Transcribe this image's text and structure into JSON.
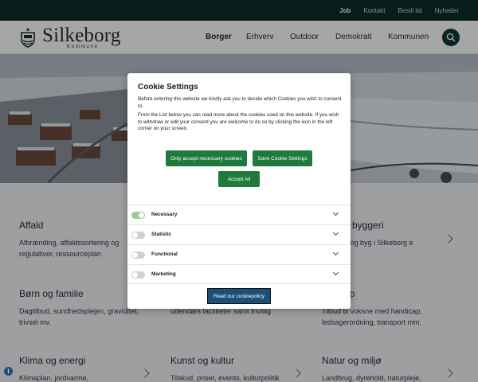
{
  "topbar": {
    "links": [
      "Job",
      "Kontakt",
      "Bestil tid",
      "Nyheder"
    ]
  },
  "header": {
    "logo_name": "Silkeborg",
    "logo_sub": "Kommune",
    "nav": [
      "Borger",
      "Erhverv",
      "Outdoor",
      "Demokrati",
      "Kommunen"
    ],
    "search_icon": "search-icon"
  },
  "cards": [
    {
      "title": "Affald",
      "desc": "Afbrænding, affaldssortering og regulativer, ressourceplan"
    },
    {
      "title": "g byggeri",
      "desc": "o og byg i Silkeborg\ne"
    },
    {
      "title": "Børn og familie",
      "desc": "Dagtilbud, sundhedsplejen, graviditet, trivsel mv."
    },
    {
      "title": "",
      "desc": "Søg tilskud, lån og leje af inde og udendørs faciliteter samt frivillig"
    },
    {
      "title": "ap",
      "desc": "Tilbud til voksne med handicap, ledsagerordning, transport mm."
    },
    {
      "title": "Klima og energi",
      "desc": "Klimaplan, jordvarme,"
    },
    {
      "title": "Kunst og kultur",
      "desc": "Tilskud, priser, events, kulturpolitik"
    },
    {
      "title": "Natur og miljø",
      "desc": "Landbrug, dyrehold, naturpleje,"
    }
  ],
  "cookie": {
    "title": "Cookie Settings",
    "p1": "Before entering this website we kindly ask you to decide which Cookies you wish to consent to.",
    "p2": "From the List below you can read more about the cookies used on this website. If you wish to withdraw or edit your consent you are welcome to do so by clicking the icon in the left corner on your screen.",
    "btn_necessary": "Only accept necessary cookies",
    "btn_save": "Save Cookie Settings",
    "btn_accept": "Accept All",
    "categories": [
      {
        "label": "Necessary",
        "on": true
      },
      {
        "label": "Statistic",
        "on": false
      },
      {
        "label": "Functional",
        "on": false
      },
      {
        "label": "Marketing",
        "on": false
      }
    ],
    "btn_policy": "Read our cookiepolicy"
  },
  "colors": {
    "topbar": "#0b2d27",
    "green_button": "#1f7a3c",
    "policy_button": "#1e4f7a",
    "toggle_on": "#8fd08f"
  },
  "info_badge": "i"
}
